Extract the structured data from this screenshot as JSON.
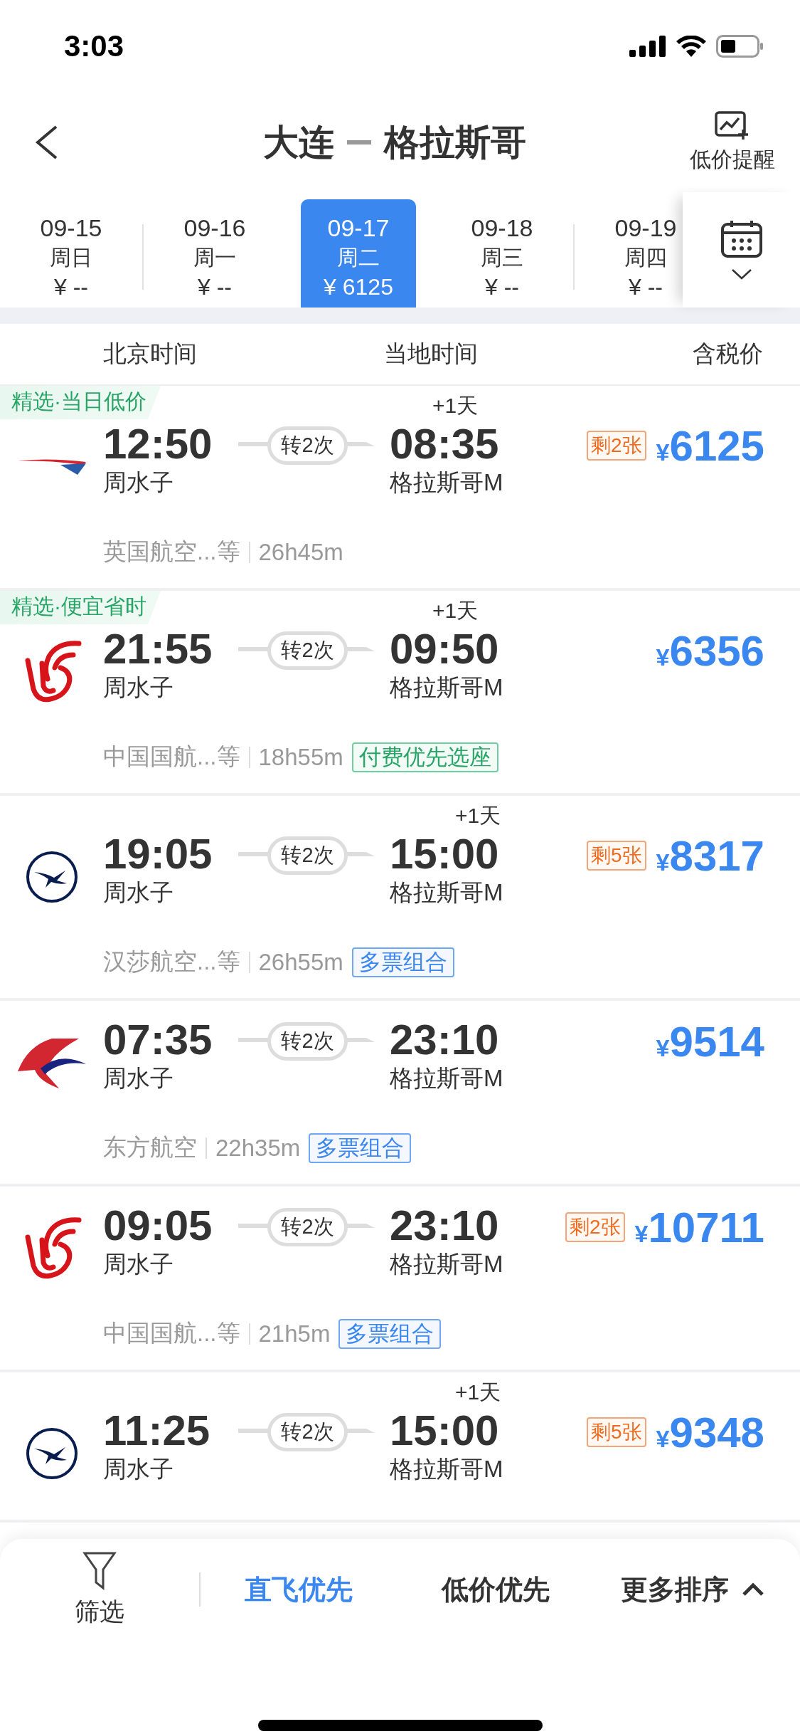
{
  "status_bar": {
    "time": "3:03"
  },
  "header": {
    "from": "大连",
    "to": "格拉斯哥",
    "alert_label": "低价提醒"
  },
  "dates": [
    {
      "date": "09-15",
      "weekday": "周日",
      "price": "¥ --",
      "selected": false
    },
    {
      "date": "09-16",
      "weekday": "周一",
      "price": "¥ --",
      "selected": false
    },
    {
      "date": "09-17",
      "weekday": "周二",
      "price": "¥ 6125",
      "selected": true
    },
    {
      "date": "09-18",
      "weekday": "周三",
      "price": "¥ --",
      "selected": false
    },
    {
      "date": "09-19",
      "weekday": "周四",
      "price": "¥ --",
      "selected": false
    }
  ],
  "columns": [
    "北京时间",
    "当地时间",
    "含税价"
  ],
  "flights": [
    {
      "tag": "精选·当日低价",
      "kind": "ba",
      "dep_time": "12:50",
      "dep_airport": "周水子",
      "transfer": "转2次",
      "day_offset": "+1天",
      "arr_time": "08:35",
      "arr_airport": "格拉斯哥M",
      "seats_left": "剩2张",
      "currency": "¥",
      "price": "6125",
      "carrier": "英国航空...等",
      "duration": "26h45m"
    },
    {
      "tag": "精选·便宜省时",
      "kind": "ca",
      "dep_time": "21:55",
      "dep_airport": "周水子",
      "transfer": "转2次",
      "day_offset": "+1天",
      "arr_time": "09:50",
      "arr_airport": "格拉斯哥M",
      "currency": "¥",
      "price": "6356",
      "carrier": "中国国航...等",
      "duration": "18h55m",
      "badge": {
        "text": "付费优先选座",
        "kind": "green"
      }
    },
    {
      "kind": "lh",
      "dep_time": "19:05",
      "dep_airport": "周水子",
      "transfer": "转2次",
      "day_offset": "+1天",
      "arr_time": "15:00",
      "arr_airport": "格拉斯哥M",
      "seats_left": "剩5张",
      "currency": "¥",
      "price": "8317",
      "carrier": "汉莎航空...等",
      "duration": "26h55m",
      "badge": {
        "text": "多票组合",
        "kind": "blue"
      }
    },
    {
      "kind": "mu",
      "dep_time": "07:35",
      "dep_airport": "周水子",
      "transfer": "转2次",
      "arr_time": "23:10",
      "arr_airport": "格拉斯哥M",
      "currency": "¥",
      "price": "9514",
      "carrier": "东方航空",
      "duration": "22h35m",
      "badge": {
        "text": "多票组合",
        "kind": "blue"
      }
    },
    {
      "kind": "ca",
      "dep_time": "09:05",
      "dep_airport": "周水子",
      "transfer": "转2次",
      "arr_time": "23:10",
      "arr_airport": "格拉斯哥M",
      "seats_left": "剩2张",
      "currency": "¥",
      "price": "10711",
      "carrier": "中国国航...等",
      "duration": "21h5m",
      "badge": {
        "text": "多票组合",
        "kind": "blue"
      }
    },
    {
      "kind": "lh",
      "dep_time": "11:25",
      "dep_airport": "周水子",
      "transfer": "转2次",
      "day_offset": "+1天",
      "arr_time": "15:00",
      "arr_airport": "格拉斯哥M",
      "seats_left": "剩5张",
      "currency": "¥",
      "price": "9348"
    }
  ],
  "sort_bar": {
    "filter_label": "筛选",
    "options": [
      {
        "label": "直飞优先",
        "selected": true
      },
      {
        "label": "低价优先",
        "selected": false
      }
    ],
    "more_label": "更多排序"
  }
}
